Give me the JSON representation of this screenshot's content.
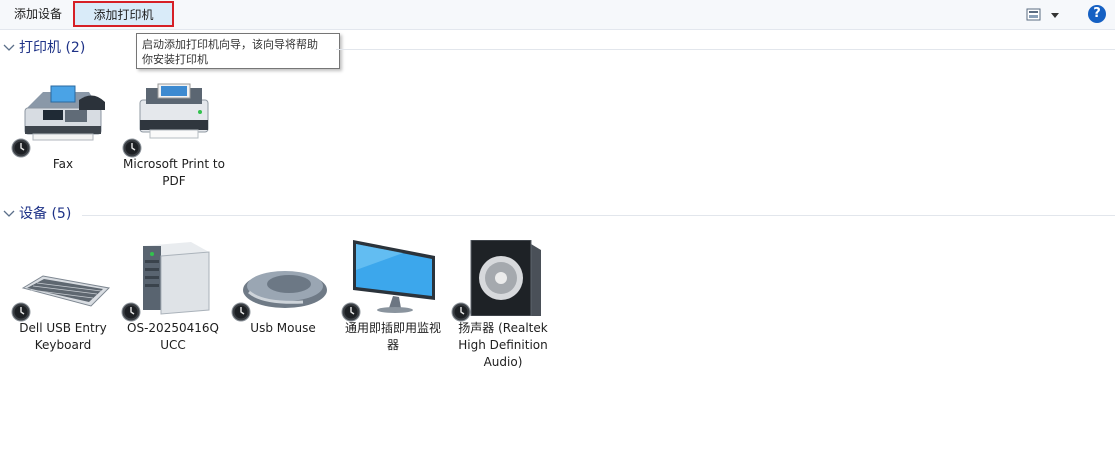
{
  "toolbar": {
    "add_device": "添加设备",
    "add_printer": "添加打印机",
    "help_glyph": "?"
  },
  "tooltip": {
    "line1": "启动添加打印机向导，该向导将帮助",
    "line2": "你安装打印机"
  },
  "groups": {
    "printers": {
      "title": "打印机 (2)"
    },
    "devices": {
      "title": "设备 (5)"
    }
  },
  "printers": [
    {
      "label": "Fax",
      "icon": "fax-icon"
    },
    {
      "label": "Microsoft Print to PDF",
      "icon": "printer-icon"
    }
  ],
  "devices": [
    {
      "label": "Dell USB Entry Keyboard",
      "icon": "keyboard-icon"
    },
    {
      "label": "OS-20250416Q UCC",
      "icon": "computer-tower-icon"
    },
    {
      "label": "Usb Mouse",
      "icon": "mouse-icon"
    },
    {
      "label": "通用即插即用监视器",
      "icon": "monitor-icon"
    },
    {
      "label": "扬声器 (Realtek High Definition Audio)",
      "icon": "speaker-icon"
    }
  ],
  "colors": {
    "accent": "#1560c3",
    "header_text": "#1e3287",
    "highlight_outline": "#d61f26",
    "toolbar_bg": "#f6f8fb"
  }
}
